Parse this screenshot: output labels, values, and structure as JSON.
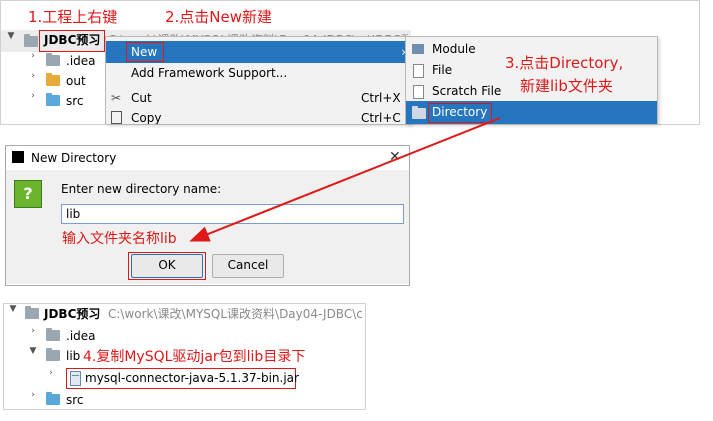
{
  "annotations": {
    "step1": "1.工程上右键",
    "step2": "2.点击New新建",
    "step3_line1": "3.点击Directory,",
    "step3_line2": "新建lib文件夹",
    "input_hint": "输入文件夹名称lib",
    "step4": "4.复制MySQL驱动jar包到lib目录下"
  },
  "top_tree": {
    "project_name": "JDBC预习",
    "project_path": "C:\\work\\课改\\MYSQL课改资料\\Day04-JDBC\\...\\JDBC预",
    "items": [
      {
        "label": ".idea",
        "color": "grey"
      },
      {
        "label": "out",
        "color": "orange"
      },
      {
        "label": "src",
        "color": "blue"
      }
    ]
  },
  "context_menu": {
    "items": [
      {
        "label": "New",
        "shortcut": "",
        "icon": "",
        "submenu": true
      },
      {
        "label": "Add Framework Support...",
        "shortcut": "",
        "icon": ""
      },
      {
        "label": "Cut",
        "shortcut": "Ctrl+X",
        "icon": "scissors-icon"
      },
      {
        "label": "Copy",
        "shortcut": "Ctrl+C",
        "icon": "copy-icon"
      }
    ]
  },
  "submenu": {
    "items": [
      {
        "label": "Module",
        "icon": "module-icon"
      },
      {
        "label": "File",
        "icon": "file-icon"
      },
      {
        "label": "Scratch File",
        "icon": "scratch-file-icon"
      },
      {
        "label": "Directory",
        "icon": "folder-icon"
      }
    ]
  },
  "dialog": {
    "title": "New Directory",
    "prompt": "Enter new directory name:",
    "input_value": "lib",
    "ok_label": "OK",
    "cancel_label": "Cancel",
    "close_glyph": "✕"
  },
  "bottom_tree": {
    "project_name": "JDBC预习",
    "project_path": "C:\\work\\课改\\MYSQL课改资料\\Day04-JDBC\\c",
    "items": [
      {
        "label": ".idea",
        "color": "grey"
      },
      {
        "label": "lib",
        "color": "grey"
      },
      {
        "label": "mysql-connector-java-5.1.37-bin.jar",
        "color": ""
      },
      {
        "label": "src",
        "color": "blue"
      }
    ]
  },
  "colors": {
    "accent_red": "#e01818",
    "selection_blue": "#2675bf"
  }
}
